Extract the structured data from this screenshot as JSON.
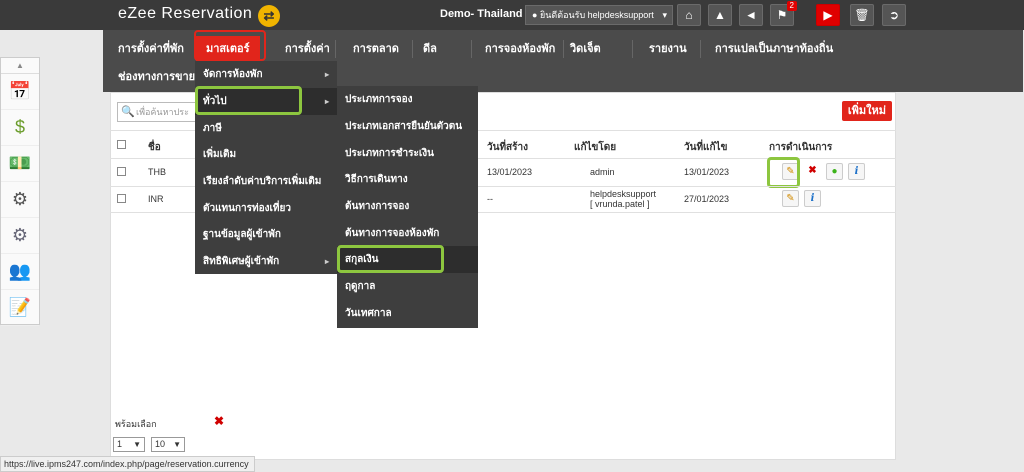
{
  "header": {
    "brand": "eZee Reservation",
    "shuffle_icon": "shuffle-icon",
    "property": "Demo- Thailand",
    "welcome": "ยินดีต้อนรับ helpdesksupport",
    "notification_count": "2"
  },
  "nav": {
    "row1": [
      "การตั้งค่าที่พัก",
      "มาสเตอร์",
      "การตั้งค่า",
      "การตลาด",
      "ดีล",
      "การจองห้องพัก",
      "วิดเจ็ต",
      "รายงาน",
      "การแปลเป็นภาษาท้องถิ่น"
    ],
    "row2": [
      "ช่องทางการขาย"
    ]
  },
  "toolbar": {
    "search_placeholder": "เพื่อค้นหาประ",
    "add_new": "เพิ่มใหม่"
  },
  "table": {
    "headers": {
      "name": "ชื่อ",
      "created_date": "วันที่สร้าง",
      "modified_by": "แก้ไขโดย",
      "modified_date": "วันที่แก้ไข",
      "actions": "การดำเนินการ"
    },
    "rows": [
      {
        "name": "THB",
        "created": "13/01/2023",
        "modified_by": "admin",
        "modified_by_2": "",
        "modified_date": "13/01/2023"
      },
      {
        "name": "INR",
        "created": "--",
        "modified_by": "helpdesksupport",
        "modified_by_2": "[ vrunda.patel ]",
        "modified_date": "27/01/2023"
      }
    ]
  },
  "master_menu": [
    {
      "label": "จัดการห้องพัก",
      "has_sub": true
    },
    {
      "label": "ทั่วไป",
      "has_sub": true
    },
    {
      "label": "ภาษี",
      "has_sub": false
    },
    {
      "label": "เพิ่มเติม",
      "has_sub": false
    },
    {
      "label": "เรียงลำดับค่าบริการเพิ่มเติม",
      "has_sub": false
    },
    {
      "label": "ตัวแทนการท่องเที่ยว",
      "has_sub": false
    },
    {
      "label": "ฐานข้อมูลผู้เข้าพัก",
      "has_sub": false
    },
    {
      "label": "สิทธิพิเศษผู้เข้าพัก",
      "has_sub": true
    }
  ],
  "general_submenu": [
    "ประเภทการจอง",
    "ประเภทเอกสารยืนยันตัวตน",
    "ประเภทการชำระเงิน",
    "วิธีการเดินทาง",
    "ต้นทางการจอง",
    "ต้นทางการจองห้องพัก",
    "สกุลเงิน",
    "ฤดูกาล",
    "วันเทศกาล"
  ],
  "footer": {
    "label": "พร้อมเลือก",
    "page": "1",
    "per_page": "10"
  },
  "status_url": "https://live.ipms247.com/index.php/page/reservation.currency"
}
